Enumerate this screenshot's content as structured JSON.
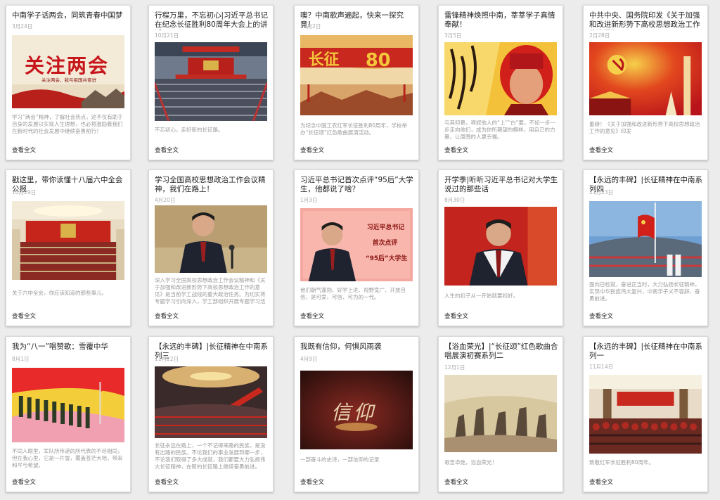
{
  "more_label": "查看全文",
  "rows": [
    [
      {
        "title": "中南学子话两会，同筑青春中国梦",
        "date": "3月24日",
        "thumb_text": "关注两会",
        "thumb_sub": "关注两会，我与祖国共奋进",
        "excerpt": "学习“两会”精神，了解社会热点，这不仅有助于自身的发展以实现人生理想，也必将激励着我们在新时代的社会发展中继续奋勇前行！"
      },
      {
        "title": "行程万里，不忘初心|习近平总书记在纪念长征胜利80周年大会上的讲话",
        "date": "10月21日",
        "thumb_text": "",
        "thumb_sub": "",
        "excerpt": "不忘初心，走好新的长征路。"
      },
      {
        "title": "噢？中南歌声遍起，快来一探究竟！",
        "date": "12月2日",
        "thumb_text": "",
        "thumb_sub": "",
        "excerpt": "为纪念中国工农红军长征胜利80周年，学校举办“长征颂”红色歌曲展演活动。"
      },
      {
        "title": "雷锋精神焕照中南，莘莘学子真情奉献！",
        "date": "3月5日",
        "thumb_text": "",
        "thumb_sub": "",
        "excerpt": "与其仰慕，称奴他人的“上”“白”要，不如一步一步走向他们，成为你所期望的模样，用自己的力量，让周围的人更幸福。"
      },
      {
        "title": "中共中央、国务院印发《关于加强和改进新形势下高校思想政治工作的意见》",
        "date": "2月28日",
        "thumb_text": "",
        "thumb_sub": "",
        "excerpt": "重磅！《关于加强和改进新形势下高校思想政治工作的意见》印发"
      }
    ],
    [
      {
        "title": "戳这里，带你读懂十八届六中全会公报",
        "date": "10月29日",
        "thumb_text": "",
        "thumb_sub": "",
        "excerpt": "关于六中全会，你应该知道的那些事儿。"
      },
      {
        "title": "学习全国高校思想政治工作会议精神，我们在路上！",
        "date": "4月20日",
        "thumb_text": "",
        "thumb_sub": "",
        "excerpt": "深入学习全国高校思想政治工作会议精神和《关于加强和改进新形势下高校思想政治工作的意见》是当前学工战线的重大政治任务。为切实将专题学习引向深入，学工部组织开展专题学习活动。"
      },
      {
        "title": "习近平总书记首次点评“95后”大学生，他都说了啥？",
        "date": "1月3日",
        "thumb_text": "",
        "thumb_sub": "",
        "excerpt": "他们朝气蓬勃、好学上进、视野宽广、开放自信，是可爱、可信、可为的一代。"
      },
      {
        "title": "开学季|听听习近平总书记对大学生说过的那些话",
        "date": "8月30日",
        "thumb_text": "",
        "thumb_sub": "",
        "excerpt": "人生的扣子从一开始就要扣好。"
      },
      {
        "title": "【永远的丰碑】|长征精神在中南系列四",
        "date": "11月23日",
        "thumb_text": "",
        "thumb_sub": "",
        "excerpt": "面向已检就，奋进正当时，大力弘扬长征精神，实现中华民族伟大复兴，中南学子义不容辞，奋勇前进。"
      }
    ],
    [
      {
        "title": "我为“八一”唱赞歌：雪覆中华",
        "date": "8月1日",
        "thumb_text": "",
        "thumb_sub": "",
        "excerpt": "不同人眼里，军队所传递的所代表的不尽相同，但在我心里，它是一片雪，覆盖苍茫大地，带来和平与希望。"
      },
      {
        "title": "【永远的丰碑】|长征精神在中南系列三",
        "date": "11月22日",
        "thumb_text": "",
        "thumb_sub": "",
        "excerpt": "长征永远在路上，一个不记得来路的民族，是没有出路的民族。不论我们的事业发展到哪一步，不论我们取得了多大成就，我们都要大力弘扬伟大长征精神，在新的长征路上继续奋勇前进。"
      },
      {
        "title": "我既有信仰，何惧风雨袭",
        "date": "4月9日",
        "thumb_text": "信仰",
        "thumb_sub": "",
        "excerpt": "一部奋斗的史诗，一部信仰的记录"
      },
      {
        "title": "【浴血荣光】|“长征颂”红色歌曲合唱展演初赛系列二",
        "date": "12月1日",
        "thumb_text": "",
        "thumb_sub": "",
        "excerpt": "艰苦卓绝，浴血荣光！"
      },
      {
        "title": "【永远的丰碑】|长征精神在中南系列一",
        "date": "11月14日",
        "thumb_text": "",
        "thumb_sub": "",
        "excerpt": "致敬红军长征胜利80周年。"
      }
    ]
  ]
}
